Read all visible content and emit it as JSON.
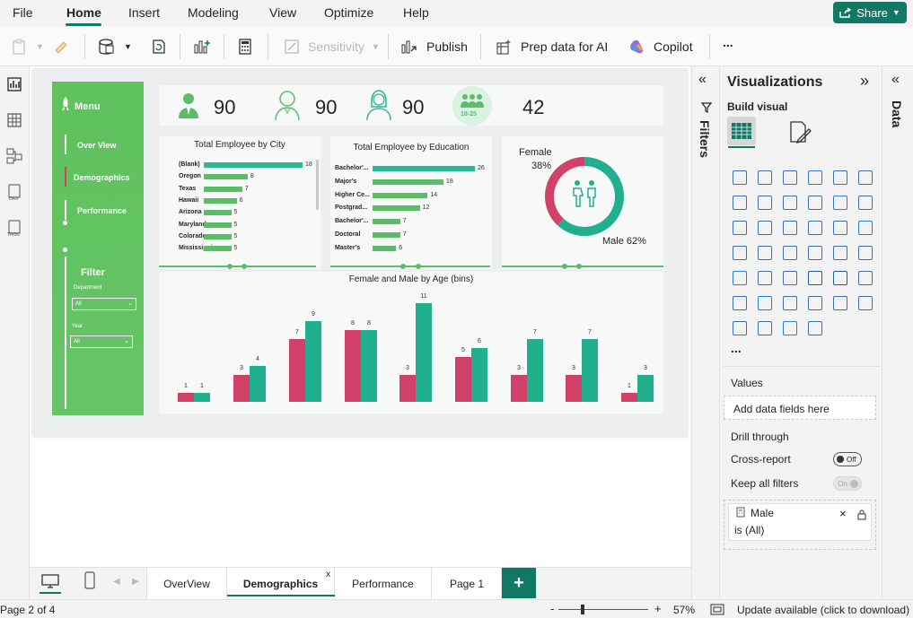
{
  "menubar": {
    "items": [
      "File",
      "Home",
      "Insert",
      "Modeling",
      "View",
      "Optimize",
      "Help"
    ],
    "share": "Share"
  },
  "ribbon": {
    "sensitivity": "Sensitivity",
    "publish": "Publish",
    "prep": "Prep data for AI",
    "copilot": "Copilot",
    "more": "..."
  },
  "report": {
    "menu_title": "Menu",
    "nav": [
      "Over View",
      "Demographics",
      "Performance"
    ],
    "filter": {
      "title": "Filter",
      "department_label": "Department",
      "department_value": "All",
      "year_label": "Year",
      "year_value": "All"
    },
    "kpis": [
      {
        "value": "90"
      },
      {
        "value": "90"
      },
      {
        "value": "90"
      },
      {
        "value": "42",
        "badge": "18-25"
      }
    ],
    "city_chart": {
      "title": "Total Employee by City",
      "categories": [
        "(Blank)",
        "Oregon",
        "Texas",
        "Hawaii",
        "Arizona",
        "Maryland",
        "Colorado",
        "Mississippi"
      ],
      "values": [
        18,
        8,
        7,
        6,
        5,
        5,
        5,
        5
      ]
    },
    "edu_chart": {
      "title": "Total Employee by Education",
      "categories": [
        "Bachelor'...",
        "Major's",
        "Higher Ce...",
        "Postgrad...",
        "Bachelor'...",
        "Doctoral",
        "Master's"
      ],
      "values": [
        26,
        18,
        14,
        12,
        7,
        7,
        6
      ]
    },
    "donut": {
      "female_label": "Female",
      "female_pct": "38%",
      "male_label": "Male 62%",
      "female": 38,
      "male": 62
    },
    "age_chart": {
      "title": "Female and Male by Age (bins)",
      "female": [
        1,
        3,
        7,
        8,
        3,
        5,
        3,
        3,
        1
      ],
      "male": [
        1,
        4,
        9,
        8,
        11,
        6,
        7,
        7,
        3
      ]
    }
  },
  "chart_data": [
    {
      "type": "bar",
      "title": "Total Employee by City",
      "categories": [
        "(Blank)",
        "Oregon",
        "Texas",
        "Hawaii",
        "Arizona",
        "Maryland",
        "Colorado",
        "Mississippi"
      ],
      "values": [
        18,
        8,
        7,
        6,
        5,
        5,
        5,
        5
      ]
    },
    {
      "type": "bar",
      "title": "Total Employee by Education",
      "categories": [
        "Bachelor'...",
        "Major's",
        "Higher Ce...",
        "Postgrad...",
        "Bachelor'...",
        "Doctoral",
        "Master's"
      ],
      "values": [
        26,
        18,
        14,
        12,
        7,
        7,
        6
      ]
    },
    {
      "type": "pie",
      "categories": [
        "Female",
        "Male"
      ],
      "values": [
        38,
        62
      ]
    },
    {
      "type": "bar",
      "title": "Female and Male by Age (bins)",
      "series": [
        {
          "values": [
            1,
            3,
            7,
            8,
            3,
            5,
            3,
            3,
            1
          ]
        },
        {
          "values": [
            1,
            4,
            9,
            8,
            11,
            6,
            7,
            7,
            3
          ]
        }
      ]
    }
  ],
  "filters_pane": {
    "label": "Filters"
  },
  "viz_pane": {
    "title": "Visualizations",
    "build_visual": "Build visual",
    "more": "...",
    "values_label": "Values",
    "add_fields": "Add data fields here",
    "drill_through": "Drill through",
    "cross_report": "Cross-report",
    "cross_toggle": "Off",
    "keep_filters": "Keep all filters",
    "keep_toggle": "On",
    "filter_field": "Male",
    "filter_value": "is (All)"
  },
  "data_pane": {
    "label": "Data"
  },
  "pages": {
    "tabs": [
      "OverView",
      "Demographics",
      "Performance",
      "Page 1"
    ],
    "active": "Demographics",
    "add": "+"
  },
  "status": {
    "page": "Page 2 of 4",
    "zoom": "57%",
    "update": "Update available (click to download)",
    "minus": "-",
    "plus": "+"
  },
  "colors": {
    "accent": "#117865",
    "female": "#d2416a",
    "male": "#20b08d",
    "sidebar": "#62c360"
  }
}
